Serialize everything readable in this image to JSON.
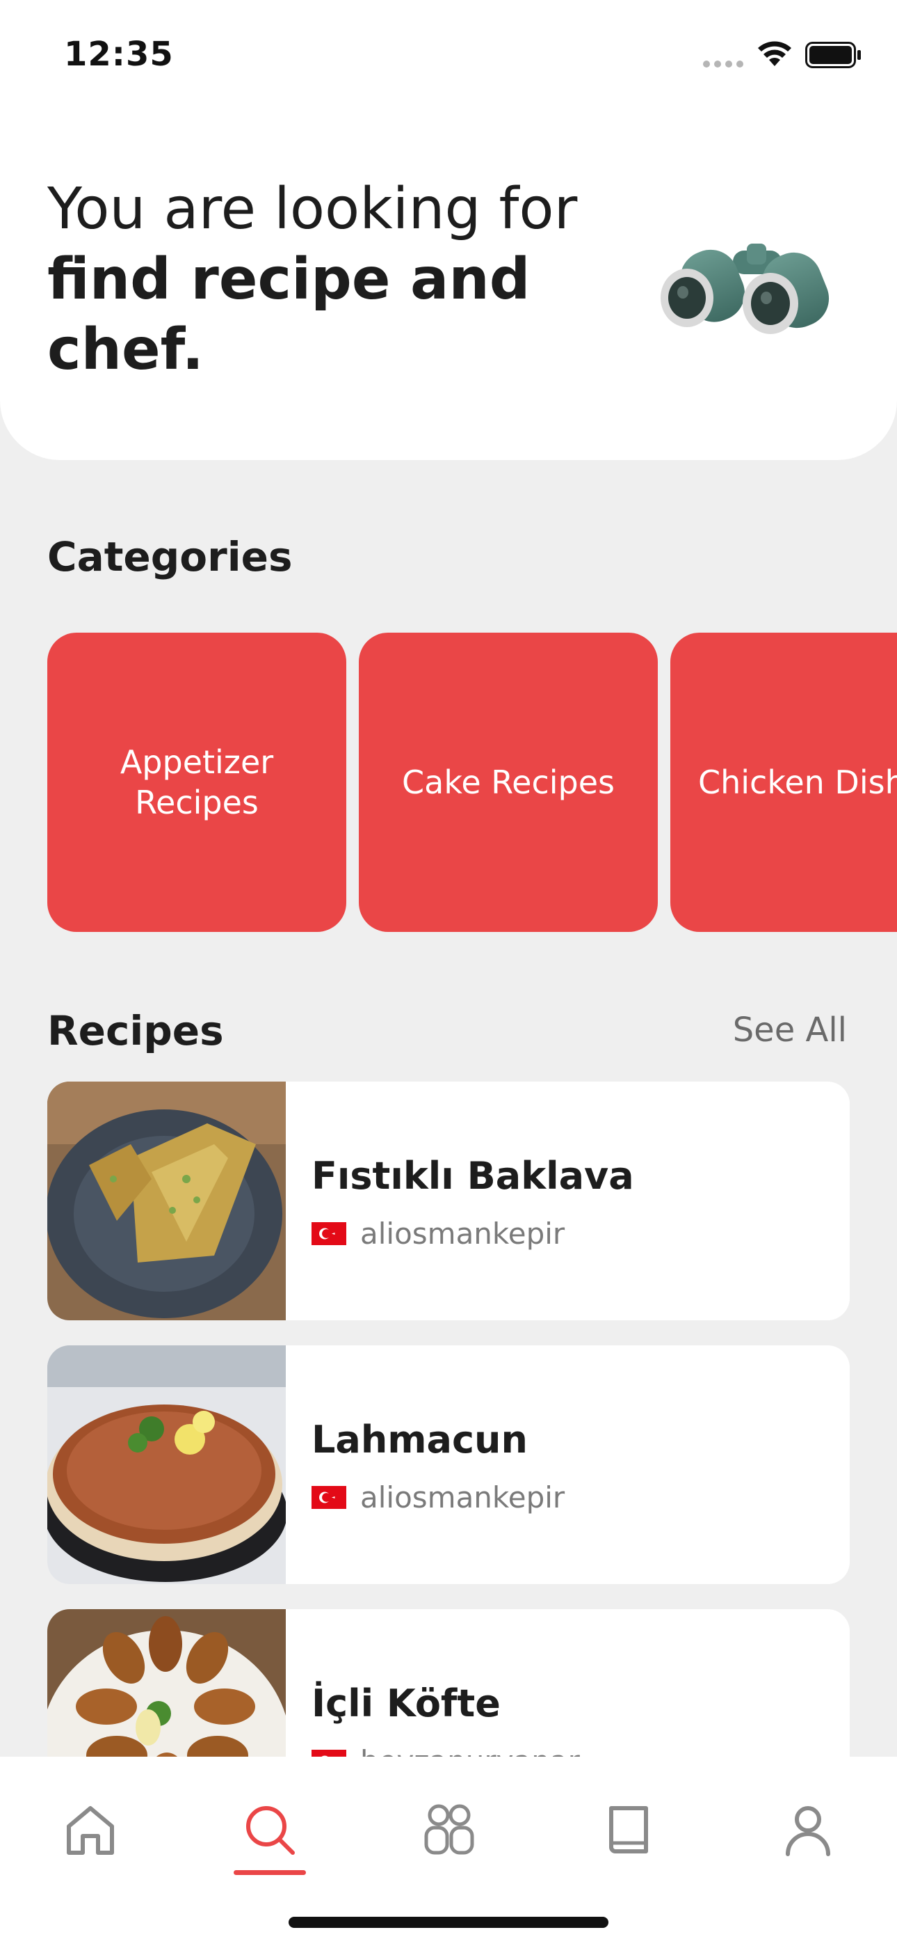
{
  "status_bar": {
    "time": "12:35"
  },
  "hero": {
    "line1": "You are looking for",
    "line2": "find recipe and chef."
  },
  "categories": {
    "title": "Categories",
    "items": [
      {
        "label": "Appetizer Recipes"
      },
      {
        "label": "Cake Recipes"
      },
      {
        "label": "Chicken Dishes"
      }
    ]
  },
  "recipes": {
    "title": "Recipes",
    "see_all_label": "See All",
    "items": [
      {
        "name": "Fıstıklı Baklava",
        "author": "aliosmankepir"
      },
      {
        "name": "Lahmacun",
        "author": "aliosmankepir"
      },
      {
        "name": "İçli Köfte",
        "author": "beyzanurvanar"
      }
    ]
  },
  "tab_bar": {
    "active_tab": "search",
    "tabs": [
      {
        "icon": "home-icon"
      },
      {
        "icon": "search-icon"
      },
      {
        "icon": "community-icon"
      },
      {
        "icon": "book-icon"
      },
      {
        "icon": "profile-icon"
      }
    ]
  },
  "colors": {
    "accent": "#ea4647",
    "background": "#efefef",
    "card": "#ffffff",
    "text": "#1d1d1d",
    "muted": "#7a7a7a"
  }
}
